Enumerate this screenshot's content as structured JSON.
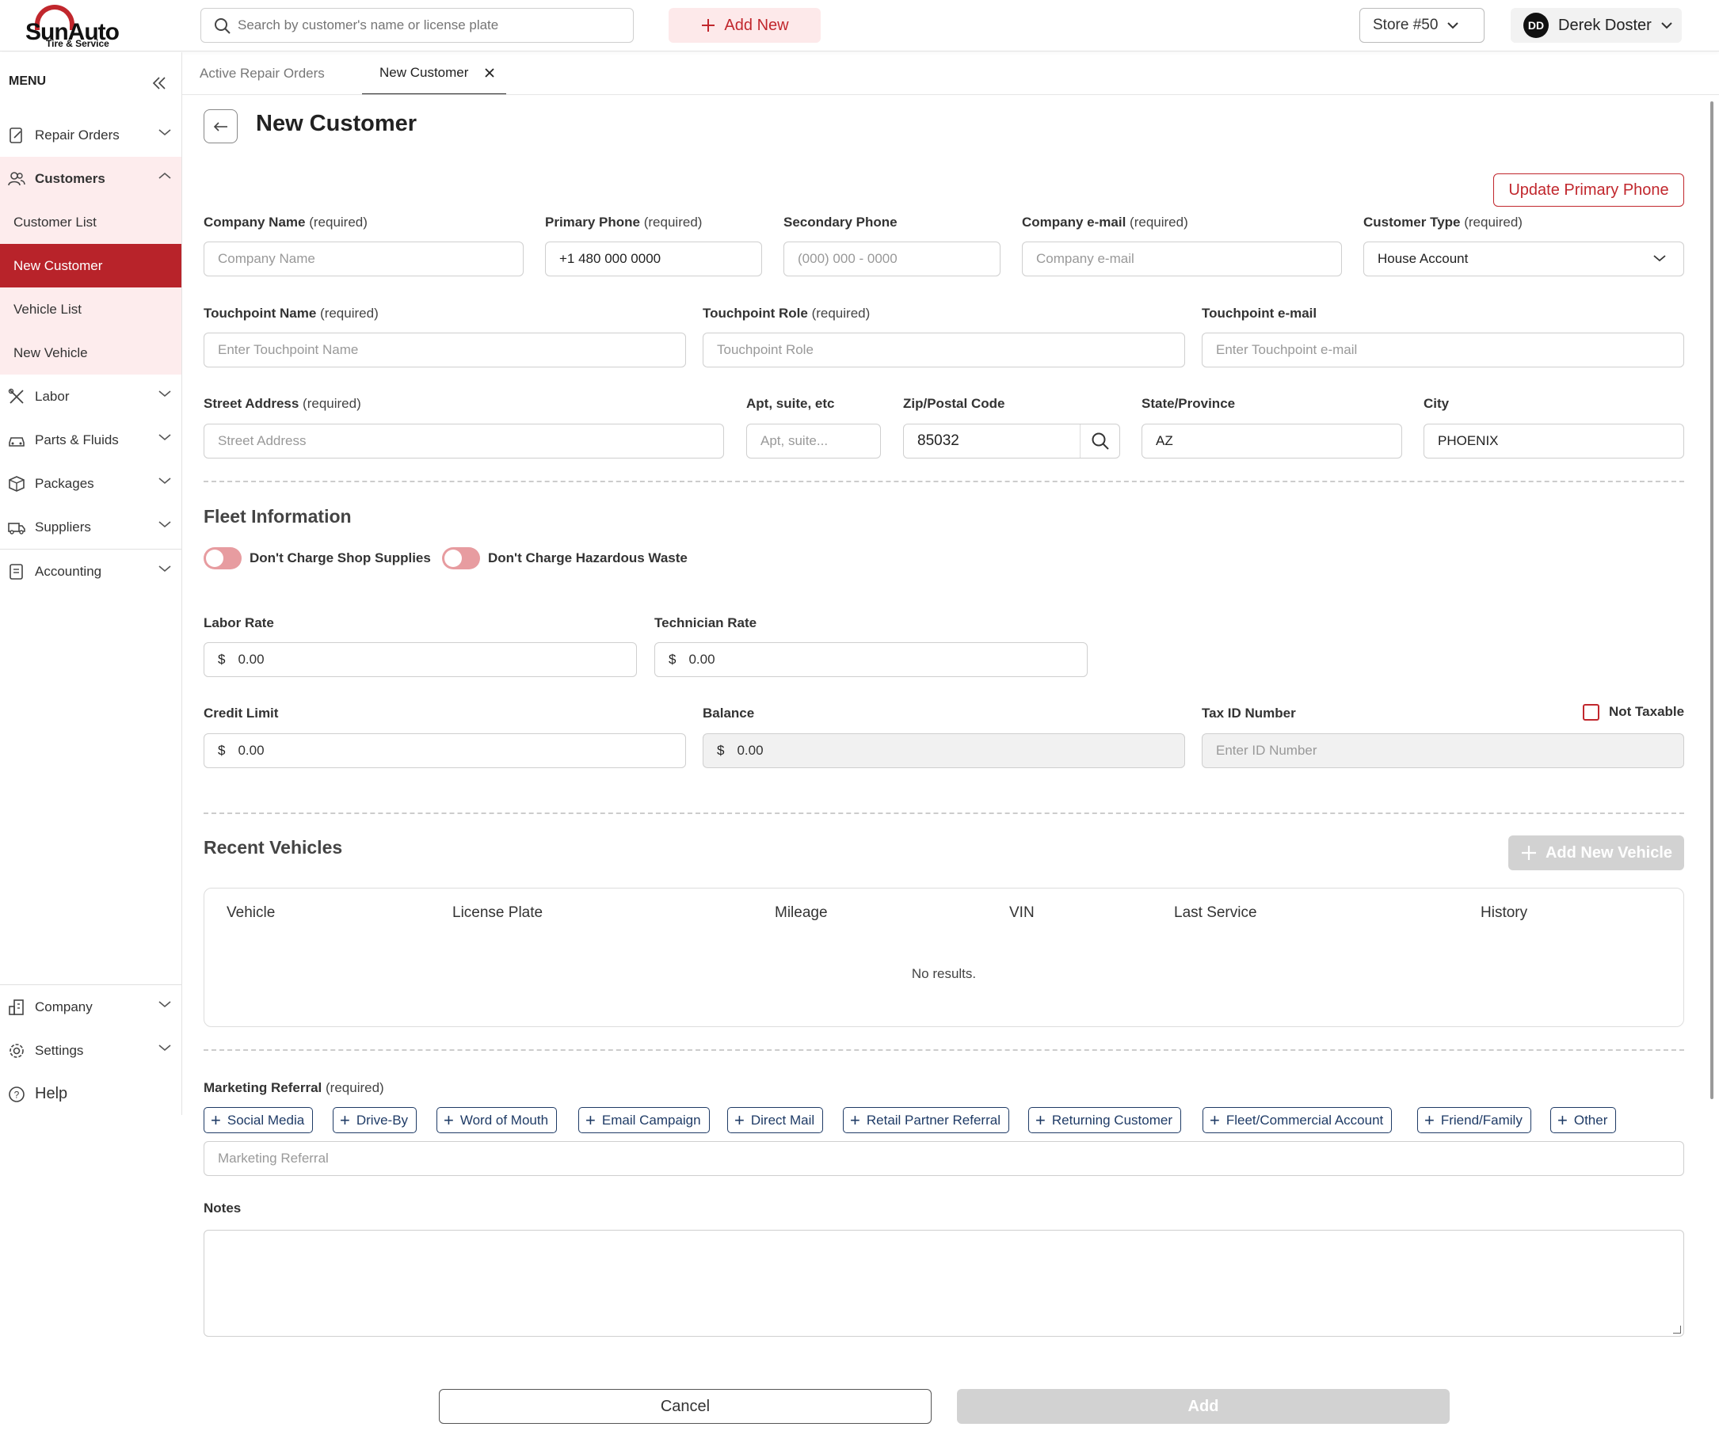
{
  "brand": {
    "name": "SunAuto",
    "tagline": "Tire & Service",
    "accent": "#c1272d"
  },
  "topbar": {
    "search_placeholder": "Search by customer's name or license plate",
    "add_new_label": "Add New",
    "store_label": "Store #50",
    "user_initials": "DD",
    "user_name": "Derek Doster"
  },
  "sidebar": {
    "menu_label": "MENU",
    "items": [
      {
        "label": "Repair Orders",
        "icon": "document-pen-icon"
      },
      {
        "label": "Customers",
        "icon": "users-icon"
      },
      {
        "label": "Labor",
        "icon": "tools-icon"
      },
      {
        "label": "Parts & Fluids",
        "icon": "car-icon"
      },
      {
        "label": "Packages",
        "icon": "box-icon"
      },
      {
        "label": "Suppliers",
        "icon": "truck-icon"
      },
      {
        "label": "Accounting",
        "icon": "ledger-icon"
      },
      {
        "label": "Company",
        "icon": "building-icon"
      },
      {
        "label": "Settings",
        "icon": "gear-icon"
      },
      {
        "label": "Help",
        "icon": "help-icon"
      }
    ],
    "customer_subitems": [
      "Customer List",
      "New Customer",
      "Vehicle List",
      "New Vehicle"
    ]
  },
  "tabs": [
    {
      "label": "Active Repair Orders"
    },
    {
      "label": "New Customer"
    }
  ],
  "page": {
    "title": "New Customer",
    "update_phone_label": "Update Primary Phone"
  },
  "form": {
    "required": "(required)",
    "company_name": {
      "label": "Company Name",
      "placeholder": "Company Name"
    },
    "primary_phone": {
      "label": "Primary Phone",
      "value": "+1 480 000 0000"
    },
    "secondary_phone": {
      "label": "Secondary Phone",
      "placeholder": "(000) 000 - 0000"
    },
    "company_email": {
      "label": "Company e-mail",
      "placeholder": "Company e-mail"
    },
    "customer_type": {
      "label": "Customer Type",
      "value": "House Account"
    },
    "touchpoint_name": {
      "label": "Touchpoint Name",
      "placeholder": "Enter Touchpoint Name"
    },
    "touchpoint_role": {
      "label": "Touchpoint Role",
      "placeholder": "Touchpoint Role"
    },
    "touchpoint_email": {
      "label": "Touchpoint e-mail",
      "placeholder": "Enter Touchpoint e-mail"
    },
    "street": {
      "label": "Street Address",
      "placeholder": "Street Address"
    },
    "apt": {
      "label": "Apt, suite, etc",
      "placeholder": "Apt, suite..."
    },
    "zip": {
      "label": "Zip/Postal Code",
      "value": "85032"
    },
    "state": {
      "label": "State/Province",
      "value": "AZ"
    },
    "city": {
      "label": "City",
      "value": "PHOENIX"
    }
  },
  "fleet": {
    "title": "Fleet Information",
    "toggle_shop_supplies": "Don't Charge Shop Supplies",
    "toggle_hazardous": "Don't Charge Hazardous Waste",
    "currency": "$",
    "labor_rate": {
      "label": "Labor Rate",
      "value": "0.00"
    },
    "technician_rate": {
      "label": "Technician Rate",
      "value": "0.00"
    },
    "credit_limit": {
      "label": "Credit Limit",
      "value": "0.00"
    },
    "balance": {
      "label": "Balance",
      "value": "0.00"
    },
    "tax_id": {
      "label": "Tax ID Number",
      "placeholder": "Enter ID Number"
    },
    "not_taxable_label": "Not Taxable"
  },
  "vehicles": {
    "title": "Recent Vehicles",
    "add_label": "Add New Vehicle",
    "columns": [
      "Vehicle",
      "License Plate",
      "Mileage",
      "VIN",
      "Last Service",
      "History"
    ],
    "empty_text": "No results."
  },
  "marketing": {
    "label": "Marketing Referral",
    "options": [
      "Social Media",
      "Drive-By",
      "Word of Mouth",
      "Email Campaign",
      "Direct Mail",
      "Retail Partner Referral",
      "Returning Customer",
      "Fleet/Commercial Account",
      "Friend/Family",
      "Other"
    ],
    "placeholder": "Marketing Referral"
  },
  "notes": {
    "label": "Notes"
  },
  "actions": {
    "cancel_label": "Cancel",
    "add_label": "Add"
  }
}
